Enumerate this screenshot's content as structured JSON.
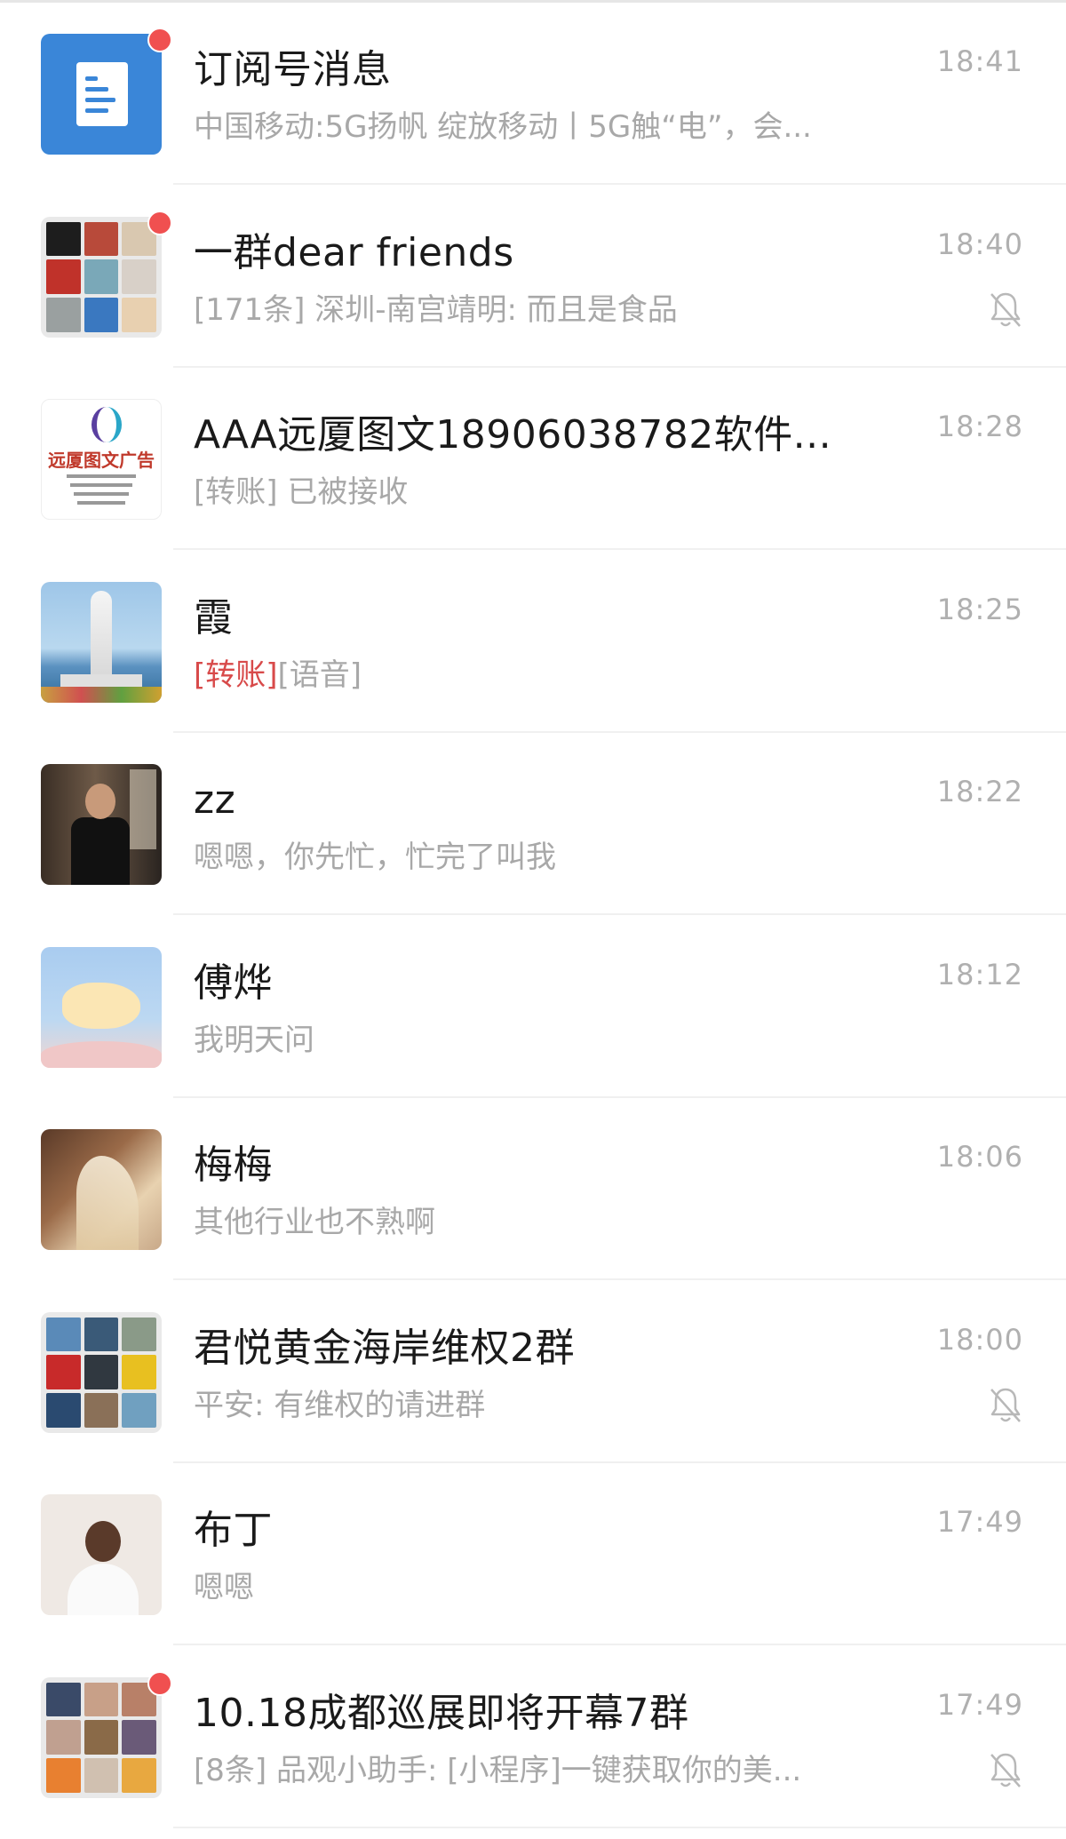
{
  "chats": [
    {
      "name": "订阅号消息",
      "preview": "中国移动:5G扬帆 绽放移动丨5G触“电”，会...",
      "preview_tag": "",
      "time": "18:41",
      "unread_dot": true,
      "muted": false,
      "avatar": "subscription-icon"
    },
    {
      "name": "一群dear  friends",
      "preview": "[171条] 深圳-南宫靖明: 而且是食品",
      "preview_tag": "",
      "time": "18:40",
      "unread_dot": true,
      "muted": true,
      "avatar": "group-grid"
    },
    {
      "name": "AAA远厦图文18906038782软件...",
      "preview": "[转账] 已被接收",
      "preview_tag": "",
      "time": "18:28",
      "unread_dot": false,
      "muted": false,
      "avatar": "company-logo",
      "logo_text": "远厦图文广告"
    },
    {
      "name": "霞",
      "preview": "[语音]",
      "preview_tag": "[转账]",
      "time": "18:25",
      "unread_dot": false,
      "muted": false,
      "avatar": "statue-photo"
    },
    {
      "name": "zz",
      "preview": "嗯嗯，你先忙，忙完了叫我",
      "preview_tag": "",
      "time": "18:22",
      "unread_dot": false,
      "muted": false,
      "avatar": "man-photo"
    },
    {
      "name": "傅烨",
      "preview": "我明天问",
      "preview_tag": "",
      "time": "18:12",
      "unread_dot": false,
      "muted": false,
      "avatar": "cartoon"
    },
    {
      "name": "梅梅",
      "preview": "其他行业也不熟啊",
      "preview_tag": "",
      "time": "18:06",
      "unread_dot": false,
      "muted": false,
      "avatar": "girl-photo"
    },
    {
      "name": "君悦黄金海岸维权2群",
      "preview": "平安: 有维权的请进群",
      "preview_tag": "",
      "time": "18:00",
      "unread_dot": false,
      "muted": true,
      "avatar": "group-grid"
    },
    {
      "name": "布丁",
      "preview": "嗯嗯",
      "preview_tag": "",
      "time": "17:49",
      "unread_dot": false,
      "muted": false,
      "avatar": "portrait-photo"
    },
    {
      "name": "10.18成都巡展即将开幕7群",
      "preview": "[8条] 品观小助手: [小程序]一键获取你的美...",
      "preview_tag": "",
      "time": "17:49",
      "unread_dot": true,
      "muted": true,
      "avatar": "group-grid"
    }
  ],
  "colors": {
    "unread_dot": "#f05050",
    "preview_tag": "#d84a4a",
    "subscription_bg": "#3a86d8",
    "muted_icon": "#b8b8b8"
  }
}
